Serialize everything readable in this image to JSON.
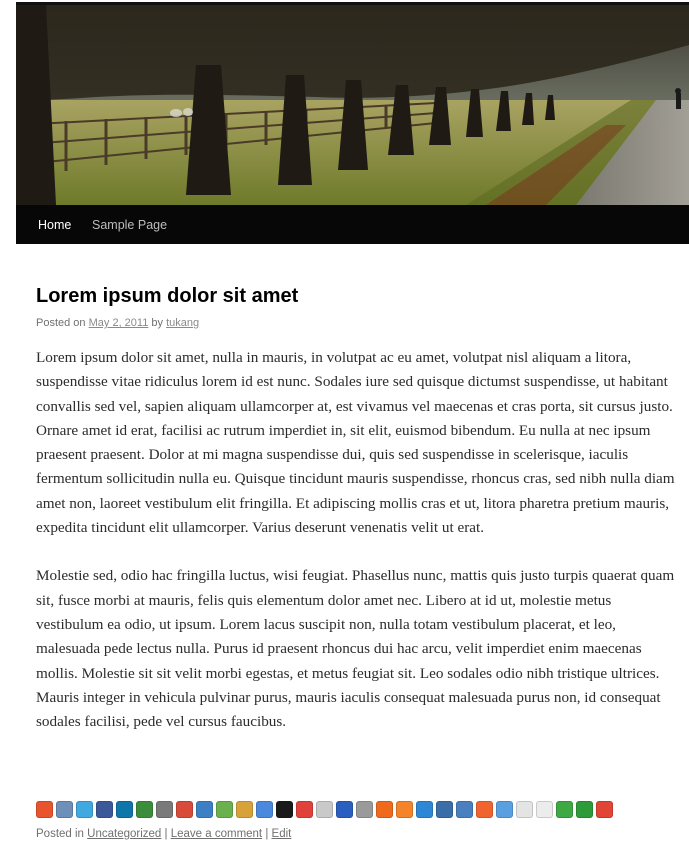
{
  "nav": {
    "items": [
      {
        "label": "Home",
        "current": true
      },
      {
        "label": "Sample Page",
        "current": false
      }
    ]
  },
  "post": {
    "title": "Lorem ipsum dolor sit amet",
    "posted_on_label": "Posted on",
    "date": "May 2, 2011",
    "by_label": "by",
    "author": "tukang",
    "paragraphs": [
      "Lorem ipsum dolor sit amet, nulla in mauris, in volutpat ac eu amet, volutpat nisl aliquam a litora, suspendisse vitae ridiculus lorem id est nunc. Sodales iure sed quisque dictumst suspendisse, ut habitant convallis sed vel, sapien aliquam ullamcorper at, est vivamus vel maecenas et cras porta, sit cursus justo. Ornare amet id erat, facilisi ac rutrum imperdiet in, sit elit, euismod bibendum. Eu nulla at nec ipsum praesent praesent. Dolor at mi magna suspendisse dui, quis sed suspendisse in scelerisque, iaculis fermentum sollicitudin nulla eu. Quisque tincidunt mauris suspendisse, rhoncus cras, sed nibh nulla diam amet non, laoreet vestibulum elit fringilla. Et adipiscing mollis cras et ut, litora pharetra pretium mauris, expedita tincidunt elit ullamcorper. Varius deserunt venenatis velit ut erat.",
      "Molestie sed, odio hac fringilla luctus, wisi feugiat. Phasellus nunc, mattis quis justo turpis quaerat quam sit, fusce morbi at mauris, felis quis elementum dolor amet nec. Libero at id ut, molestie metus vestibulum ea odio, ut ipsum. Lorem lacus suscipit non, nulla totam vestibulum placerat, et leo, malesuada pede lectus nulla. Purus id praesent rhoncus dui hac arcu, velit imperdiet enim maecenas mollis. Molestie sit sit velit morbi egestas, et metus feugiat sit. Leo sodales odio nibh tristique ultrices. Mauris integer in vehicula pulvinar purus, mauris iaculis consequat malesuada purus non, id consequat sodales facilisi, pede vel cursus faucibus."
    ]
  },
  "share_icons": [
    {
      "name": "addthis-icon",
      "color": "#e8542e"
    },
    {
      "name": "bookmark-icon",
      "color": "#6d8fb8"
    },
    {
      "name": "twitter-icon",
      "color": "#3fa9e0"
    },
    {
      "name": "facebook-icon",
      "color": "#3b5998"
    },
    {
      "name": "linkedin-icon",
      "color": "#0e76a8"
    },
    {
      "name": "stumbleupon-icon",
      "color": "#3b8c3b"
    },
    {
      "name": "delicious-icon",
      "color": "#7a7a7a"
    },
    {
      "name": "netvibes-icon",
      "color": "#d84a3a"
    },
    {
      "name": "profile-icon",
      "color": "#3c7fc4"
    },
    {
      "name": "evernote-icon",
      "color": "#6ab04c"
    },
    {
      "name": "cookie-icon",
      "color": "#d8a23a"
    },
    {
      "name": "translate-icon",
      "color": "#4a89dc"
    },
    {
      "name": "myspace-icon",
      "color": "#1a1a1a"
    },
    {
      "name": "blinklist-icon",
      "color": "#e0413a"
    },
    {
      "name": "amazon-icon",
      "color": "#c9c9c9"
    },
    {
      "name": "paw-icon",
      "color": "#2b5fbf"
    },
    {
      "name": "rss-arrow-icon",
      "color": "#9a9a9a"
    },
    {
      "name": "blogger-icon",
      "color": "#f06a1e"
    },
    {
      "name": "blogger-alt-icon",
      "color": "#f5832a"
    },
    {
      "name": "bebo-icon",
      "color": "#2d87d5"
    },
    {
      "name": "buzz-icon",
      "color": "#3b6ea8"
    },
    {
      "name": "feed-icon",
      "color": "#4a7fc0"
    },
    {
      "name": "hackernews-icon",
      "color": "#f0652f"
    },
    {
      "name": "windows-icon",
      "color": "#5aa0e0"
    },
    {
      "name": "instapaper-icon",
      "color": "#e4e4e4"
    },
    {
      "name": "myyahoo-icon",
      "color": "#ececec"
    },
    {
      "name": "plus-icon",
      "color": "#3ea843"
    },
    {
      "name": "upload-icon",
      "color": "#2e9b3a"
    },
    {
      "name": "block-icon",
      "color": "#e04535"
    }
  ],
  "footer": {
    "posted_in_label": "Posted in",
    "category": "Uncategorized",
    "sep1": "|",
    "comment_link": "Leave a comment",
    "sep2": "|",
    "edit_link": "Edit"
  }
}
